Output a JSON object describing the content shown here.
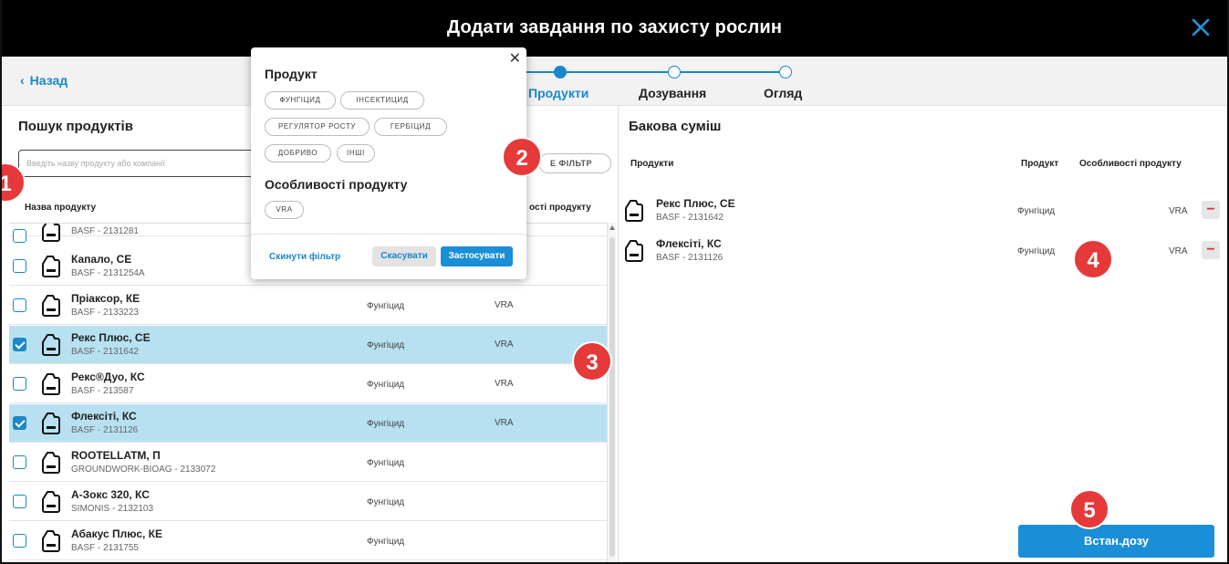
{
  "window": {
    "title": "Додати завдання по захисту рослин"
  },
  "nav": {
    "back_label": "Назад"
  },
  "stepper": {
    "steps": [
      {
        "label": "Продукти",
        "state": "active"
      },
      {
        "label": "Дозування",
        "state": "pending"
      },
      {
        "label": "Огляд",
        "state": "pending"
      }
    ]
  },
  "search": {
    "title": "Пошук продуктів",
    "placeholder": "Введіть назву продукту або компанії",
    "filter_label": "Е ФІЛЬТР",
    "columns": {
      "name": "Назва продукту",
      "features": "ості продукту"
    },
    "products": [
      {
        "name": "",
        "code": "BASF - 2131281",
        "type": "",
        "feature": "",
        "checked": false
      },
      {
        "name": "Капало, СЕ",
        "code": "BASF - 2131254A",
        "type": "",
        "feature": "",
        "checked": false
      },
      {
        "name": "Пріаксор, КЕ",
        "code": "BASF - 2133223",
        "type": "Фунгіцид",
        "feature": "VRA",
        "checked": false
      },
      {
        "name": "Рекс Плюс, СЕ",
        "code": "BASF - 2131642",
        "type": "Фунгіцид",
        "feature": "VRA",
        "checked": true
      },
      {
        "name": "Рекс®Дуо, КС",
        "code": "BASF - 213587",
        "type": "Фунгіцид",
        "feature": "VRA",
        "checked": false
      },
      {
        "name": "Флексіті, КС",
        "code": "BASF - 2131126",
        "type": "Фунгіцид",
        "feature": "VRA",
        "checked": true
      },
      {
        "name": "ROOTELLATM, П",
        "code": "GROUNDWORK-BIOAG - 2133072",
        "type": "Фунгіцид",
        "feature": "",
        "checked": false
      },
      {
        "name": "А-Зокс 320, КС",
        "code": "SIMONIS - 2132103",
        "type": "Фунгіцид",
        "feature": "",
        "checked": false
      },
      {
        "name": "Абакус Плюс, КЕ",
        "code": "BASF - 2131755",
        "type": "Фунгіцид",
        "feature": "",
        "checked": false
      }
    ]
  },
  "filter_popup": {
    "product_heading": "Продукт",
    "product_chips": [
      "ФУНГІЦИД",
      "ІНСЕКТИЦИД",
      "РЕГУЛЯТОР РОСТУ",
      "ГЕРБІЦИД",
      "ДОБРИВО",
      "ІНШІ"
    ],
    "features_heading": "Особливості продукту",
    "feature_chips": [
      "VRA"
    ],
    "reset_label": "Скинути фільтр",
    "cancel_label": "Скасувати",
    "apply_label": "Застосувати"
  },
  "tank_mix": {
    "title": "Бакова суміш",
    "columns": {
      "products": "Продукти",
      "product": "Продукт",
      "features": "Особливості продукту"
    },
    "items": [
      {
        "name": "Рекс Плюс, СЕ",
        "code": "BASF - 2131642",
        "type": "Фунгіцид",
        "feature": "VRA"
      },
      {
        "name": "Флексіті, КС",
        "code": "BASF - 2131126",
        "type": "Фунгіцид",
        "feature": "VRA"
      }
    ],
    "set_dose_label": "Встан.дозу"
  },
  "markers": [
    "1",
    "2",
    "3",
    "4",
    "5"
  ],
  "colors": {
    "accent": "#1a87c9",
    "selected_row": "#b7e1f0",
    "marker": "#e5393a",
    "titlebar": "#000000"
  }
}
